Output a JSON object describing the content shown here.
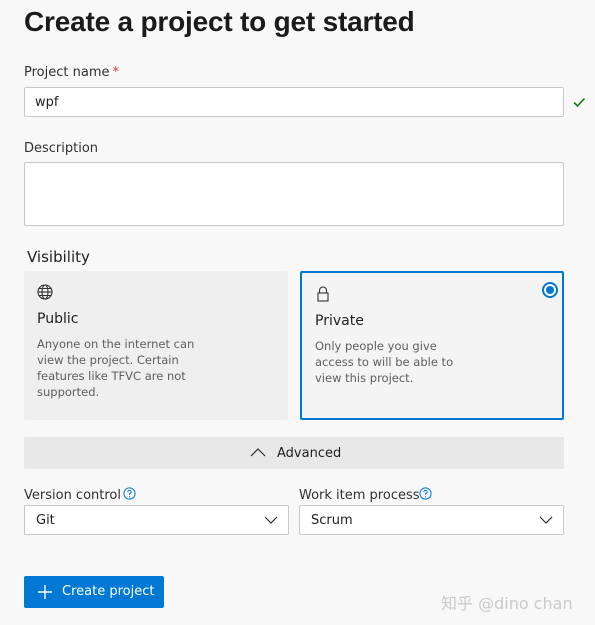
{
  "page": {
    "title": "Create a project to get started"
  },
  "project_name": {
    "label": "Project name",
    "required_marker": "*",
    "value": "wpf"
  },
  "description": {
    "label": "Description",
    "value": ""
  },
  "visibility": {
    "title": "Visibility",
    "options": [
      {
        "icon": "globe-icon",
        "title": "Public",
        "description": "Anyone on the internet can view the project. Certain features like TFVC are not supported.",
        "selected": false
      },
      {
        "icon": "lock-icon",
        "title": "Private",
        "description": "Only people you give access to will be able to view this project.",
        "selected": true
      }
    ]
  },
  "advanced": {
    "label": "Advanced",
    "expanded": true
  },
  "version_control": {
    "label": "Version control",
    "value": "Git"
  },
  "work_item_process": {
    "label": "Work item process",
    "value": "Scrum"
  },
  "actions": {
    "create_label": "Create project"
  },
  "watermark": {
    "text": "知乎 @dino chan"
  },
  "colors": {
    "accent": "#0078d4",
    "valid_check": "#107c10",
    "required": "#d13438"
  }
}
